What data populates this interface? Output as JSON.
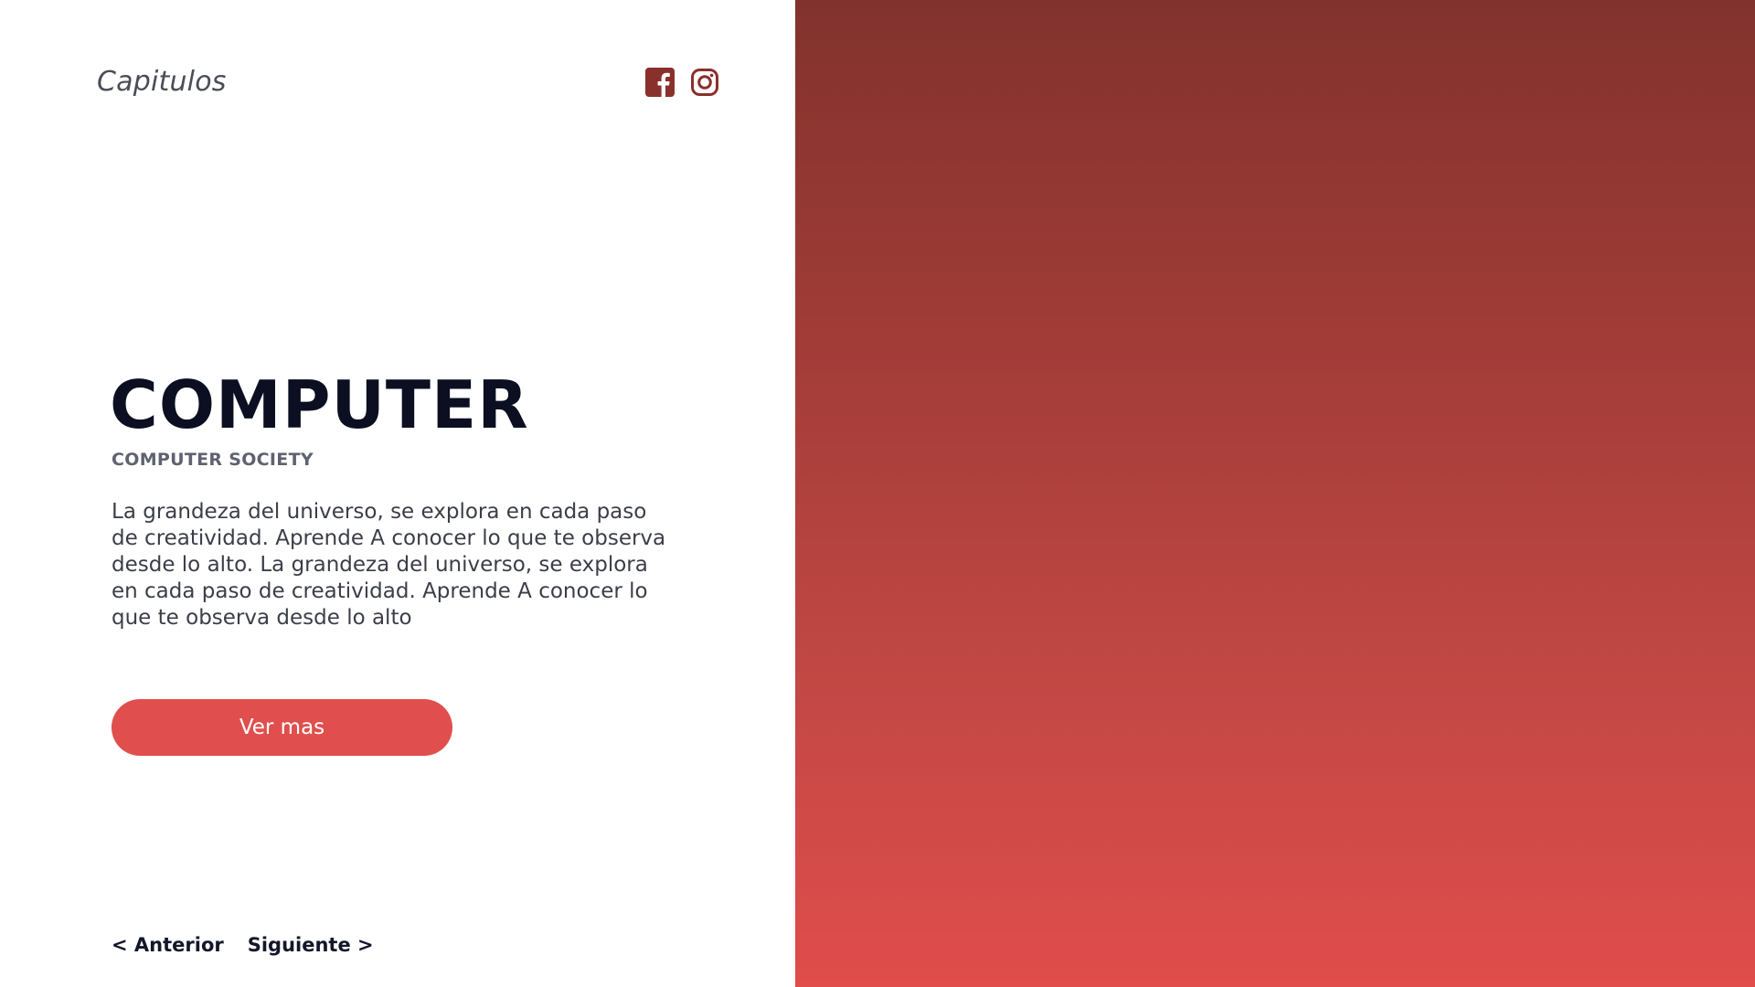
{
  "header": {
    "brand": "Capitulos",
    "social": [
      {
        "icon": "facebook-icon"
      },
      {
        "icon": "instagram-icon"
      }
    ]
  },
  "hero": {
    "title": "COMPUTER",
    "subtitle": "COMPUTER SOCIETY",
    "body": "La grandeza del universo, se explora en cada paso de creatividad. Aprende A conocer lo que te observa desde lo alto. La grandeza del universo, se explora en cada paso de creatividad. Aprende A conocer lo que te observa desde lo alto",
    "cta_label": "Ver mas"
  },
  "pager": {
    "prev_label": "< Anterior",
    "next_label": "Siguiente >"
  },
  "colors": {
    "accent": "#e04f4d",
    "icon": "#8a302c",
    "panel_top": "#82322d",
    "panel_bottom": "#e04d4b",
    "title": "#0b0f21"
  }
}
